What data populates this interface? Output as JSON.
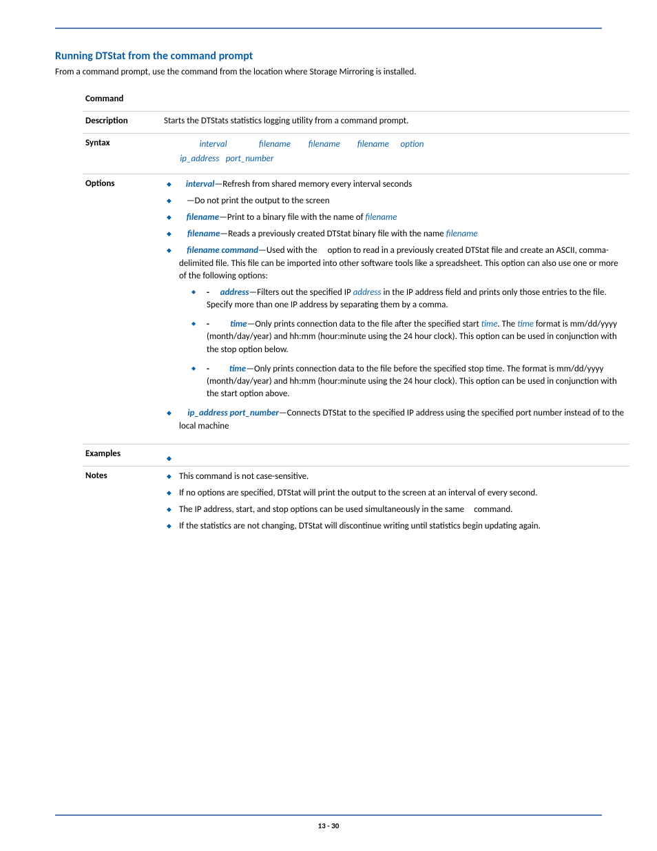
{
  "title": "Running DTStat from the command prompt",
  "intro_before": "From a command prompt, use the ",
  "intro_mid": " command from the location where Storage Mirroring is installed.",
  "labels": {
    "command": "Command",
    "description": "Description",
    "syntax": "Syntax",
    "options": "Options",
    "examples": "Examples",
    "notes": "Notes"
  },
  "description_text": "Starts the DTStats statistics logging utility from a command prompt.",
  "syntax": {
    "p_interval": "interval",
    "p_filename": "filename",
    "p_option": "option",
    "p_ip": "ip_address",
    "p_port": "port_number"
  },
  "options": {
    "opt1_a": "interval",
    "opt1_b": "—Refresh from shared memory every interval seconds",
    "opt2": "—Do not print the output to the screen",
    "opt3_a": "filename",
    "opt3_b": "—Print to a binary file with the name of ",
    "opt3_c": "filename",
    "opt4_a": "filename",
    "opt4_b": "—Reads a previously created DTStat binary file with the name ",
    "opt4_c": "filename",
    "opt5_a": "filename command",
    "opt5_b": "—Used with the ",
    "opt5_c": " option to read in a previously created DTStat file and create an ASCII, comma-delimited file. This file can be imported into other software tools like a spreadsheet. This option can also use one or more of the following options:",
    "sub1_pre": "- ",
    "sub1_a": "address",
    "sub1_b": "—Filters out the specified IP ",
    "sub1_c": "address",
    "sub1_d": " in the IP address field and prints only those entries to the file. Specify more than one IP address by separating them by a comma.",
    "sub2_pre": "- ",
    "sub2_a": "time",
    "sub2_b": "—Only prints connection data to the file after the specified start ",
    "sub2_c": "time",
    "sub2_d": ". The ",
    "sub2_e": "time",
    "sub2_f": " format is mm/dd/yyyy (month/day/year) and hh:mm (hour:minute using the 24 hour clock). This option can be used in conjunction with the stop option below.",
    "sub3_pre": "- ",
    "sub3_a": "time",
    "sub3_b": "—Only prints connection data to the file before the specified stop time. The format is mm/dd/yyyy (month/day/year) and hh:mm (hour:minute using the 24 hour clock). This option can be used in conjunction with the start option above.",
    "opt6_a": "ip_address port_number",
    "opt6_b": "—Connects DTStat to the specified IP address using the specified port number instead of to the local machine"
  },
  "examples": {
    "e1": "",
    "e2": "",
    "e3": "",
    "e4": "",
    "e5": "",
    "e6": ""
  },
  "notes": {
    "n1": "This command is not case-sensitive.",
    "n2": "If no options are specified, DTStat will print the output to the screen at an interval of every second.",
    "n3_a": "The IP address, start, and stop options can be used simultaneously in the same ",
    "n3_b": " command.",
    "n4": "If the statistics are not changing, DTStat will discontinue writing until statistics begin updating again."
  },
  "footer": "13 - 30"
}
